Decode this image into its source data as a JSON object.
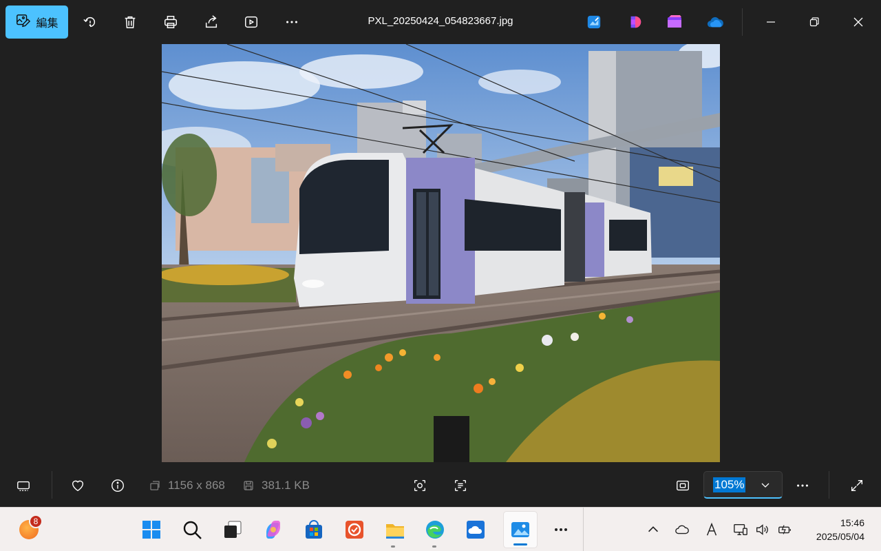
{
  "toolbar": {
    "edit_label": "編集",
    "filename": "PXL_20250424_054823667.jpg",
    "icons": [
      "edit-image-icon",
      "rotate-icon",
      "delete-icon",
      "print-icon",
      "share-icon",
      "slideshow-icon",
      "more-icon"
    ],
    "app_icons": [
      "photos-editor-app-icon",
      "clipchamp-icon",
      "designer-icon",
      "onedrive-icon"
    ]
  },
  "bottombar": {
    "dimensions": "1156 x 868",
    "file_size": "381.1 KB",
    "zoom": "105%"
  },
  "taskbar": {
    "widget_badge": "8",
    "time": "15:46",
    "date": "2025/05/04"
  },
  "colors": {
    "accent": "#4cc2ff",
    "selection": "#0078d4",
    "background": "#202020",
    "taskbar": "#f3efee"
  }
}
